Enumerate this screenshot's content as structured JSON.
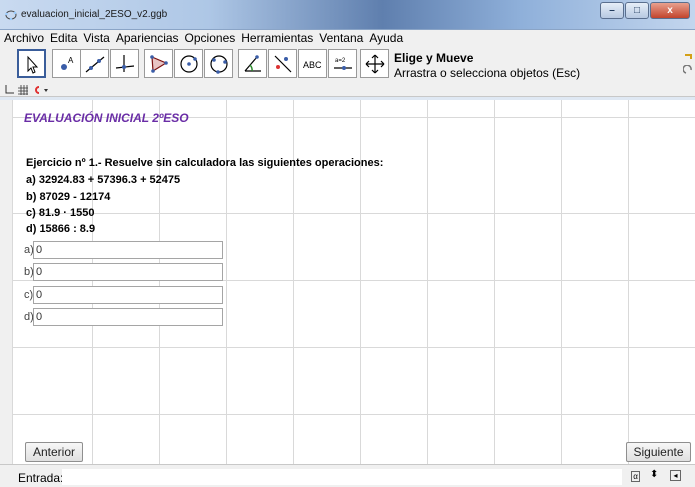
{
  "window": {
    "title": "evaluacion_inicial_2ESO_v2.ggb",
    "minimize": "–",
    "maximize": "□",
    "close": "x"
  },
  "menu": [
    "Archivo",
    "Edita",
    "Vista",
    "Apariencias",
    "Opciones",
    "Herramientas",
    "Ventana",
    "Ayuda"
  ],
  "toolbar": {
    "tools": [
      "move-tool",
      "point-tool",
      "line-tool",
      "perpendicular-tool",
      "polygon-tool",
      "circle-tool",
      "conic-tool",
      "angle-tool",
      "reflect-tool",
      "text-tool",
      "slider-tool",
      "move-graphics-tool"
    ],
    "text_tool_label": "ABC",
    "slider_tool_label": "a=2",
    "active_tool_title": "Elige y Mueve",
    "active_tool_desc": "Arrastra o selecciona objetos (Esc)"
  },
  "canvas": {
    "heading": "EVALUACIÓN INICIAL 2ºESO",
    "exercise_title": "Ejercicio nº 1.- Resuelve sin calculadora las siguientes operaciones:",
    "operations": [
      "a) 32924.83 + 57396.3 + 52475",
      "b) 87029 - 12174",
      "c) 81.9 · 1550",
      "d) 15866 : 8.9"
    ],
    "fields": [
      {
        "label": "a)",
        "value": "0"
      },
      {
        "label": "b)",
        "value": "0"
      },
      {
        "label": "c)",
        "value": "0"
      },
      {
        "label": "d)",
        "value": "0"
      }
    ],
    "prev_button": "Anterior",
    "next_button": "Siguiente"
  },
  "input_bar": {
    "label": "Entrada:",
    "value": ""
  },
  "colors": {
    "heading": "#6a2da6",
    "active_tool_border": "#3a5d9a"
  }
}
